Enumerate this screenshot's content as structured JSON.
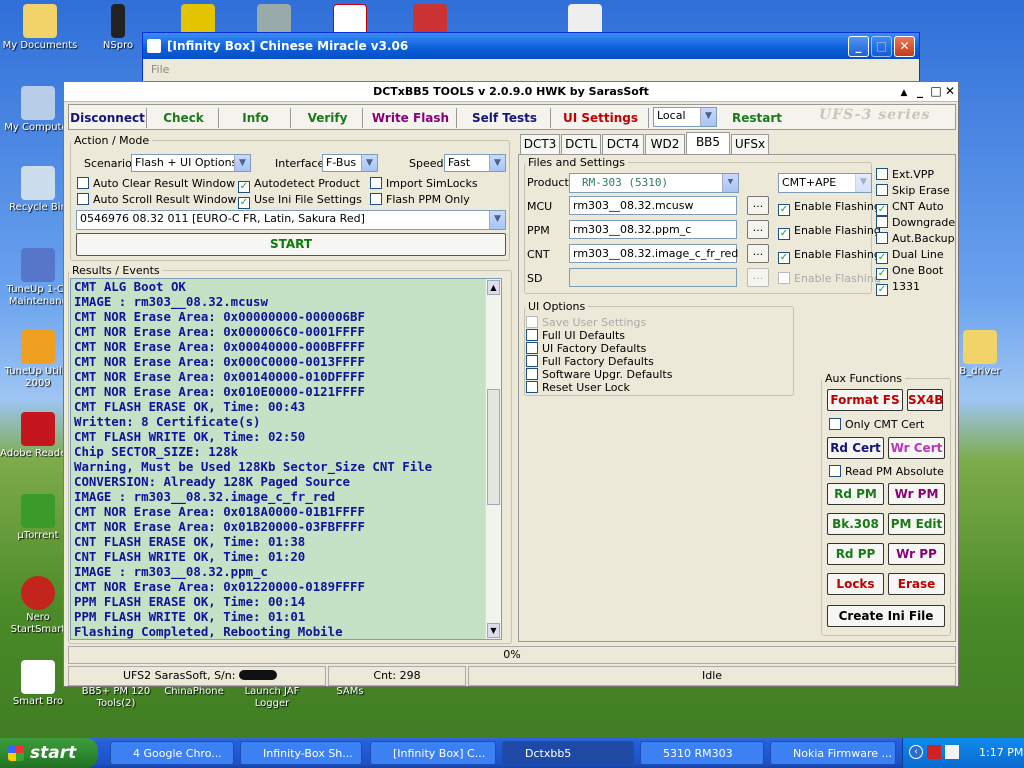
{
  "desktop_icons": [
    {
      "label": "My Documents",
      "icon": "folder-icon"
    },
    {
      "label": "NSpro",
      "icon": "phone-icon"
    },
    {
      "label": "My Computer",
      "icon": "computer-icon"
    },
    {
      "label": "Recycle Bin",
      "icon": "recycle-bin-icon"
    },
    {
      "label": "TuneUp 1-Cli Maintenanc",
      "icon": "tuneup-icon"
    },
    {
      "label": "TuneUp Utiliti 2009",
      "icon": "tuneup-utilities-icon"
    },
    {
      "label": "Adobe Reade 8",
      "icon": "adobe-reader-icon"
    },
    {
      "label": "µTorrent",
      "icon": "utorrent-icon"
    },
    {
      "label": "Nero StartSmart",
      "icon": "nero-icon"
    },
    {
      "label": "Smart Bro",
      "icon": "smart-bro-icon"
    },
    {
      "label": "BB5+ PM 120 Tools(2)",
      "icon": "tool-icon"
    },
    {
      "label": "ChinaPhone",
      "icon": "chinaphone-icon"
    },
    {
      "label": "Launch JAF Logger",
      "icon": "jaf-icon"
    },
    {
      "label": "SAMs",
      "icon": "sams-icon"
    },
    {
      "label": "B_driver",
      "icon": "driver-icon"
    }
  ],
  "bg_window": {
    "title": "[Infinity Box] Chinese Miracle v3.06",
    "menu": "File"
  },
  "window": {
    "title": "DCTxBB5 TOOLS v 2.0.9.0 HWK by SarasSoft"
  },
  "toolbar": {
    "disconnect": "Disconnect",
    "check": "Check",
    "info": "Info",
    "verify": "Verify",
    "write_flash": "Write Flash",
    "self_tests": "Self Tests",
    "ui_settings": "UI Settings",
    "mode_value": "Local",
    "restart": "Restart",
    "series": "UFS-3  series"
  },
  "action": {
    "legend": "Action / Mode",
    "scenario_label": "Scenario",
    "scenario_value": "Flash + UI Options",
    "interface_label": "Interface",
    "interface_value": "F-Bus",
    "speed_label": "Speed",
    "speed_value": "Fast",
    "auto_clear": "Auto Clear Result Window",
    "auto_scroll": "Auto Scroll Result Window",
    "autodetect": "Autodetect Product",
    "use_ini": "Use Ini File Settings",
    "import_simlocks": "Import SimLocks",
    "flash_ppm": "Flash PPM Only",
    "firmware_value": "0546976 08.32 011  [EURO-C FR, Latin, Sakura Red]",
    "start": "START"
  },
  "results": {
    "legend": "Results / Events",
    "lines": [
      "CMT ALG Boot OK",
      "IMAGE : rm303__08.32.mcusw",
      "CMT NOR Erase Area: 0x00000000-000006BF",
      "CMT NOR Erase Area: 0x000006C0-0001FFFF",
      "CMT NOR Erase Area: 0x00040000-000BFFFF",
      "CMT NOR Erase Area: 0x000C0000-0013FFFF",
      "CMT NOR Erase Area: 0x00140000-010DFFFF",
      "CMT NOR Erase Area: 0x010E0000-0121FFFF",
      "CMT FLASH ERASE OK, Time: 00:43",
      "Written: 8 Certificate(s)",
      "CMT FLASH WRITE OK, Time: 02:50",
      "Chip SECTOR_SIZE: 128k",
      "Warning, Must be Used 128Kb Sector_Size CNT File",
      "CONVERSION: Already 128K Paged Source",
      "IMAGE : rm303__08.32.image_c_fr_red",
      "CMT NOR Erase Area: 0x018A0000-01B1FFFF",
      "CMT NOR Erase Area: 0x01B20000-03FBFFFF",
      "CNT FLASH ERASE OK, Time: 01:38",
      "CNT FLASH WRITE OK, Time: 01:20",
      "IMAGE : rm303__08.32.ppm_c",
      "CMT NOR Erase Area: 0x01220000-0189FFFF",
      "PPM FLASH ERASE OK, Time: 00:14",
      "PPM FLASH WRITE OK, Time: 01:01",
      "Flashing Completed, Rebooting Mobile"
    ]
  },
  "tabs": [
    "DCT3",
    "DCTL",
    "DCT4",
    "WD2",
    "BB5",
    "UFSx"
  ],
  "files": {
    "legend": "Files and Settings",
    "product_label": "Product",
    "product_value": "RM-303  (5310)",
    "product_mode": "CMT+APE",
    "mcu_label": "MCU",
    "mcu_value": "rm303__08.32.mcusw",
    "ppm_label": "PPM",
    "ppm_value": "rm303__08.32.ppm_c",
    "cnt_label": "CNT",
    "cnt_value": "rm303__08.32.image_c_fr_red",
    "sd_label": "SD",
    "sd_value": "",
    "browse": "...",
    "enable_flashing": "Enable Flashing",
    "opts": [
      "Ext.VPP",
      "Skip Erase",
      "CNT Auto",
      "Downgrade",
      "Aut.Backup",
      "Dual Line",
      "One Boot",
      "1331"
    ]
  },
  "ui_options": {
    "legend": "UI Options",
    "items": [
      "Save User Settings",
      "Full UI Defaults",
      "UI Factory Defaults",
      "Full Factory Defaults",
      "Software Upgr. Defaults",
      "Reset User Lock"
    ]
  },
  "aux": {
    "legend": "Aux Functions",
    "format_fs": "Format FS",
    "sx4b": "SX4B",
    "only_cmt_cert": "Only CMT Cert",
    "rd_cert": "Rd Cert",
    "wr_cert": "Wr Cert",
    "read_pm_absolute": "Read PM Absolute",
    "rd_pm": "Rd PM",
    "wr_pm": "Wr PM",
    "bk308": "Bk.308",
    "pm_edit": "PM Edit",
    "rd_pp": "Rd PP",
    "wr_pp": "Wr PP",
    "locks": "Locks",
    "erase": "Erase",
    "create_ini": "Create Ini File"
  },
  "progress": {
    "text": "0%",
    "value": 0
  },
  "status": {
    "left": "UFS2 SarasSoft, S/n:",
    "cnt": "Cnt: 298",
    "state": "Idle"
  },
  "taskbar": {
    "start": "start",
    "tasks": [
      "4 Google Chro...",
      "Infinity-Box Sh...",
      "[Infinity Box] C...",
      "Dctxbb5",
      "5310 RM303",
      "Nokia Firmware ..."
    ],
    "clock": "1:17 PM"
  },
  "colors": {
    "log_bg": "#c6e2c6",
    "log_text": "#12129a",
    "accent_red": "#c00000",
    "accent_green": "#1a7a1a"
  }
}
